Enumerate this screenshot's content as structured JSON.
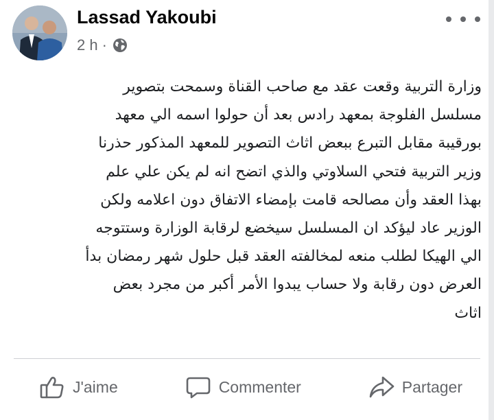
{
  "post": {
    "author": "Lassad Yakoubi",
    "time": "2 h",
    "separator": "·",
    "audience_icon": "globe-icon",
    "body_lines": [
      "وزارة التربية وقعت عقد مع  صاحب القناة وسمحت بتصوير",
      "مسلسل الفلوجة بمعهد رادس بعد أن حولوا اسمه الي معهد",
      "بورقيبة مقابل التبرع ببعض اثاث التصوير للمعهد المذكور  حذرنا",
      "وزير التربية فتحي السلاوتي والذي اتضح  انه لم يكن علي علم",
      "بهذا العقد وأن مصالحه  قامت بإمضاء الاتفاق دون اعلامه ولكن",
      "الوزير  عاد ليؤكد ان المسلسل سيخضع لرقابة الوزارة وستتوجه",
      "الي الهيكا لطلب منعه لمخالفته العقد  قبل حلول شهر رمضان  بدأ",
      "العرض  دون رقابة ولا  حساب  يبدوا الأمر أكبر من مجرد بعض",
      "اثاث"
    ]
  },
  "actions": {
    "like_label": "J'aime",
    "comment_label": "Commenter",
    "share_label": "Partager"
  },
  "colors": {
    "text_primary": "#1c1e21",
    "text_secondary": "#65676b",
    "divider": "#ced0d4"
  }
}
